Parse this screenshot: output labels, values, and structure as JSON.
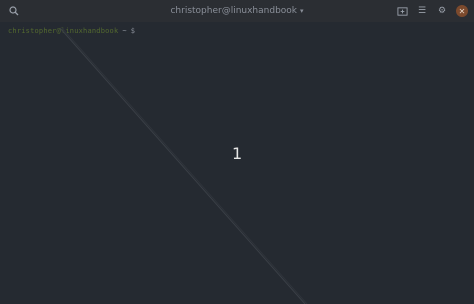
{
  "window": {
    "title": "christopher@linuxhandbook",
    "title_caret": "▾"
  },
  "icons": {
    "search": "search-icon",
    "new_tab": "new-tab-icon",
    "menu": "hamburger-menu-icon",
    "settings": "gear-icon",
    "close": "close-icon"
  },
  "icon_glyphs": {
    "menu": "☰",
    "settings": "⚙",
    "close": "✕"
  },
  "terminal": {
    "prompt_user": "christopher@linuxhandbook",
    "prompt_path": "~",
    "prompt_symbol": "$"
  },
  "overlay": {
    "number": "1"
  },
  "colors": {
    "background": "#252a31",
    "titlebar": "#2b2e33",
    "prompt_green": "#546a2f",
    "close_button": "#7c4a2d"
  }
}
